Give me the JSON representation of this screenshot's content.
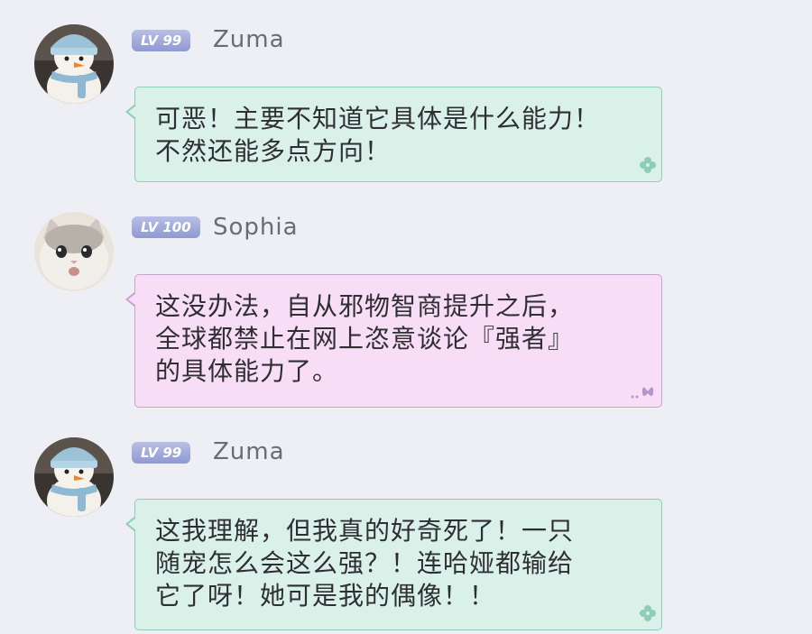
{
  "messages": [
    {
      "user": "Zuma",
      "level": "LV 99",
      "avatar": "snowman-avatar",
      "style": "green",
      "lines": [
        "可恶！主要不知道它具体是什么能力！",
        "不然还能多点方向！"
      ],
      "decoration": "clover-icon"
    },
    {
      "user": "Sophia",
      "level": "LV 100",
      "avatar": "cat-avatar",
      "style": "pink",
      "lines": [
        "这没办法，自从邪物智商提升之后，",
        "全球都禁止在网上恣意谈论『强者』",
        "的具体能力了。"
      ],
      "decoration": "butterfly-icon"
    },
    {
      "user": "Zuma",
      "level": "LV 99",
      "avatar": "snowman-avatar",
      "style": "green",
      "lines": [
        "这我理解，但我真的好奇死了！一只",
        "随宠怎么会这么强？！连哈娅都输给",
        "它了呀！她可是我的偶像！！"
      ],
      "decoration": "clover-icon"
    }
  ],
  "colors": {
    "background": "#eeeef5",
    "green_bubble": "#d9f1e9",
    "green_border": "#8fcdb8",
    "pink_bubble": "#f8ddf7",
    "pink_border": "#c9a3cf",
    "level_badge": "#9aa3d8",
    "username": "#6b6b74",
    "text": "#2e2e33"
  }
}
